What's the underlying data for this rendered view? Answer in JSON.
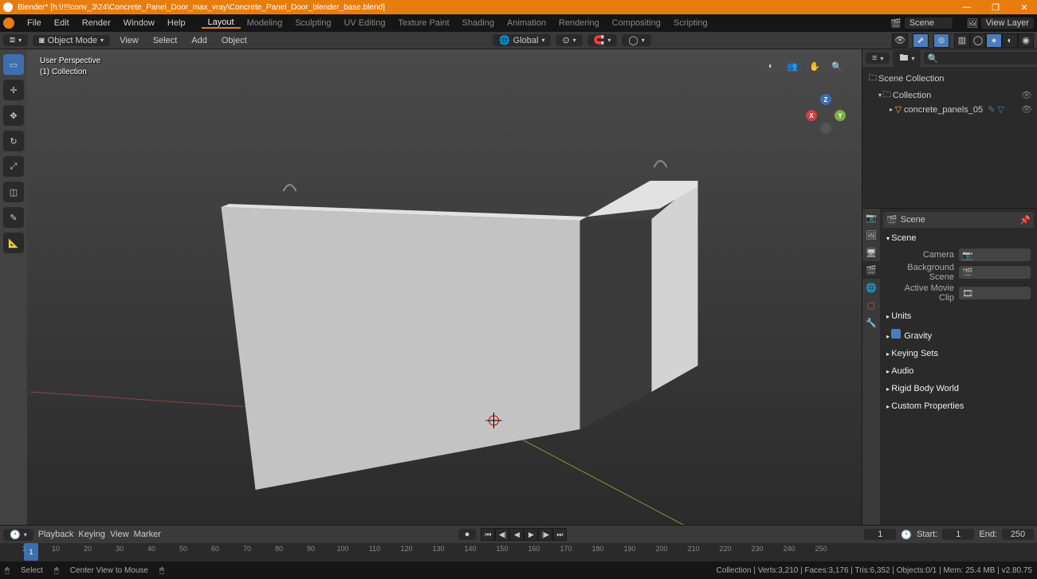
{
  "title": {
    "app": "Blender*",
    "file": "[h:\\!!!!conv_3\\24\\Concrete_Panel_Door_max_vray\\Concrete_Panel_Door_blender_base.blend]"
  },
  "window_buttons": {
    "min": "—",
    "max": "❐",
    "close": "✕"
  },
  "menu": {
    "file": "File",
    "edit": "Edit",
    "render": "Render",
    "window": "Window",
    "help": "Help"
  },
  "workspaces": {
    "layout": "Layout",
    "modeling": "Modeling",
    "sculpting": "Sculpting",
    "uv": "UV Editing",
    "texpaint": "Texture Paint",
    "shading": "Shading",
    "anim": "Animation",
    "rendering": "Rendering",
    "compositing": "Compositing",
    "scripting": "Scripting"
  },
  "top_right": {
    "scene_label": "Scene",
    "scene_value": "Scene",
    "viewlayer_label": "View Layer",
    "viewlayer_value": "View Layer"
  },
  "vp": {
    "mode": "Object Mode",
    "menus": {
      "view": "View",
      "select": "Select",
      "add": "Add",
      "object": "Object"
    },
    "orient": "Global",
    "info_line1": "User Perspective",
    "info_line2": "(1) Collection",
    "overlay": {
      "cam": "◖",
      "view": "👥",
      "pan": "✋",
      "zoom": "🔍"
    }
  },
  "outliner": {
    "search_placeholder": "",
    "scene_collection": "Scene Collection",
    "collection": "Collection",
    "object": "concrete_panels_05"
  },
  "props": {
    "crumb": "Scene",
    "panels": {
      "scene": "Scene",
      "camera_label": "Camera",
      "camera_value": "",
      "bg_label": "Background Scene",
      "bg_value": "",
      "clip_label": "Active Movie Clip",
      "clip_value": "",
      "units": "Units",
      "gravity": "Gravity",
      "keying": "Keying Sets",
      "audio": "Audio",
      "rigid": "Rigid Body World",
      "custom": "Custom Properties"
    }
  },
  "timeline": {
    "menus": {
      "playback": "Playback",
      "keying": "Keying",
      "view": "View",
      "marker": "Marker"
    },
    "play": {
      "first": "⏮",
      "keyb": "◀|",
      "prev": "◀◀",
      "revplay": "◀",
      "play": "▶",
      "next": "▶▶",
      "keyn": "|▶",
      "last": "⏭"
    },
    "current": "1",
    "start_label": "Start:",
    "start": "1",
    "end_label": "End:",
    "end": "250",
    "ticks": [
      "1",
      "10",
      "20",
      "30",
      "40",
      "50",
      "60",
      "70",
      "80",
      "90",
      "100",
      "110",
      "120",
      "130",
      "140",
      "150",
      "160",
      "170",
      "180",
      "190",
      "200",
      "210",
      "220",
      "230",
      "240",
      "250"
    ]
  },
  "status": {
    "select_icon": "▭",
    "select": "Select",
    "center_icon": "▭",
    "center": "Center View to Mouse",
    "menu_icon": "▭",
    "stats": "Collection | Verts:3,210 | Faces:3,176 | Tris:6,352 | Objects:0/1 | Mem: 25.4 MB | v2.80.75"
  }
}
